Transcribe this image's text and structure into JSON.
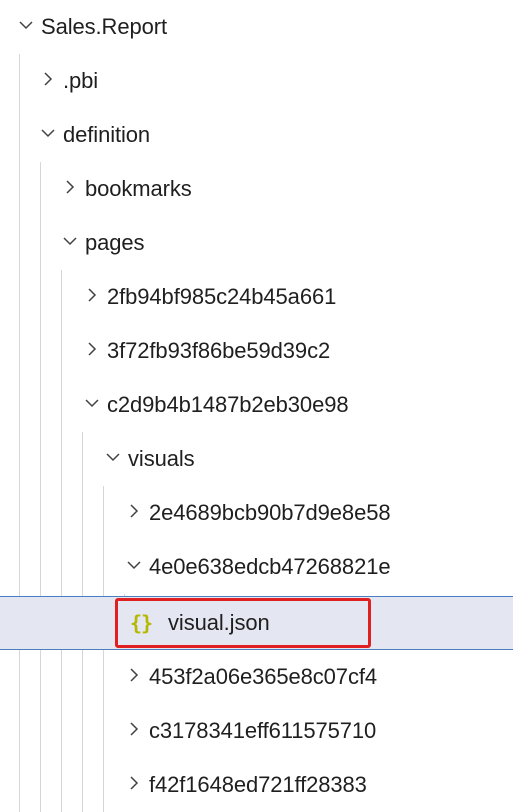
{
  "explorer": {
    "items": [
      {
        "label": "Sales.Report",
        "state": "expanded"
      },
      {
        "label": ".pbi",
        "state": "collapsed"
      },
      {
        "label": "definition",
        "state": "expanded"
      },
      {
        "label": "bookmarks",
        "state": "collapsed"
      },
      {
        "label": "pages",
        "state": "expanded"
      },
      {
        "label": "2fb94bf985c24b45a661",
        "state": "collapsed"
      },
      {
        "label": "3f72fb93f86be59d39c2",
        "state": "collapsed"
      },
      {
        "label": "c2d9b4b1487b2eb30e98",
        "state": "expanded"
      },
      {
        "label": "visuals",
        "state": "expanded"
      },
      {
        "label": "2e4689bcb90b7d9e8e58",
        "state": "collapsed"
      },
      {
        "label": "4e0e638edcb47268821e",
        "state": "expanded"
      },
      {
        "label": "visual.json",
        "state": "file",
        "icon": "json-braces-icon",
        "icon_glyph": "{}",
        "selected": true
      },
      {
        "label": "453f2a06e365e8c07cf4",
        "state": "collapsed"
      },
      {
        "label": "c3178341eff611575710",
        "state": "collapsed"
      },
      {
        "label": "f42f1648ed721ff28383",
        "state": "collapsed"
      }
    ]
  },
  "colors": {
    "selection_background": "#e4e6f1",
    "selection_border": "#4a7fbf",
    "highlight_box": "#e02020",
    "json_icon": "#b5b800",
    "indent_guide": "#d6d6d6"
  }
}
